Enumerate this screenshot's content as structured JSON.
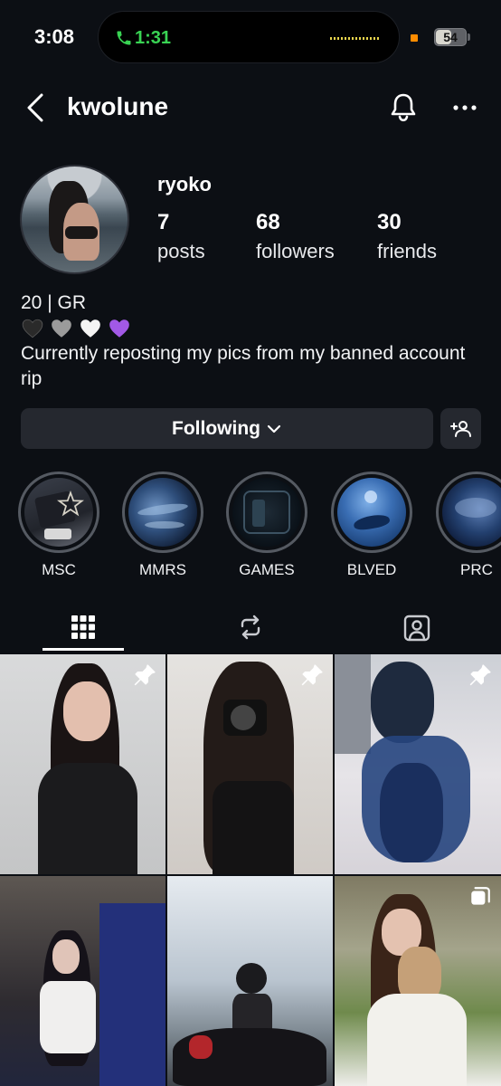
{
  "status_bar": {
    "time": "3:08",
    "call_timer": "1:31",
    "battery_percent": "54",
    "battery_level": 0.54,
    "colors": {
      "call": "#39d353",
      "recording": "#ff8c00"
    }
  },
  "header": {
    "username": "kwolune",
    "icons": [
      "chevron-left-icon",
      "bell-icon",
      "more-horizontal-icon"
    ]
  },
  "profile": {
    "display_name": "ryoko",
    "stats": [
      {
        "value": "7",
        "label": "posts"
      },
      {
        "value": "68",
        "label": "followers"
      },
      {
        "value": "30",
        "label": "friends"
      }
    ],
    "bio_line1": "20 | GR",
    "bio_hearts": [
      "🖤",
      "🩶",
      "🤍",
      "💜"
    ],
    "bio_line3": "Currently reposting my pics from my banned account rip",
    "colors": {
      "heart_black": "#2a2a2a",
      "heart_grey": "#9b9b9b",
      "heart_white": "#f4f4f4",
      "heart_purple": "#a259e6"
    }
  },
  "actions": {
    "following_label": "Following",
    "add_user_icon": "add-user-icon"
  },
  "highlights": [
    {
      "label": "MSC"
    },
    {
      "label": "MMRS"
    },
    {
      "label": "GAMES"
    },
    {
      "label": "BLVED"
    },
    {
      "label": "PRC"
    }
  ],
  "tabs": [
    {
      "icon": "grid-icon",
      "active": true
    },
    {
      "icon": "repost-icon",
      "active": false
    },
    {
      "icon": "tagged-icon",
      "active": false
    }
  ],
  "posts": [
    {
      "pinned": true
    },
    {
      "pinned": true
    },
    {
      "pinned": true
    },
    {
      "pinned": false
    },
    {
      "pinned": false
    },
    {
      "pinned": false,
      "multiple": true
    }
  ]
}
